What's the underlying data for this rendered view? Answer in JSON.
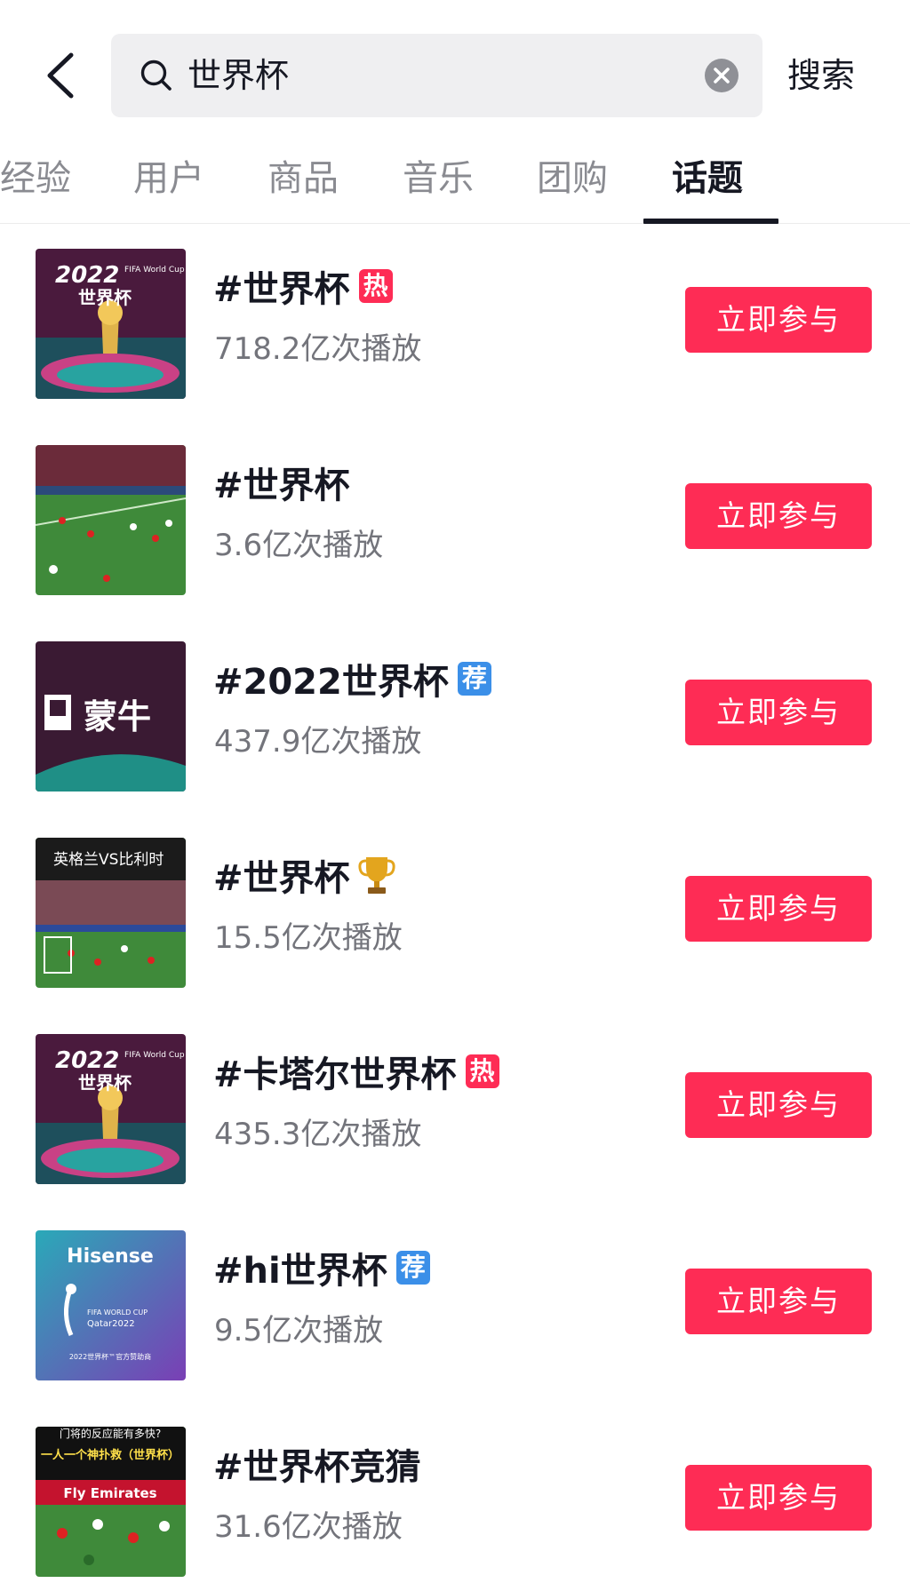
{
  "header": {
    "back_icon": "chevron-left-icon",
    "search_query": "世界杯",
    "search_icon": "search-icon",
    "clear_icon": "clear-circle-icon",
    "search_button": "搜索"
  },
  "tabs": [
    {
      "label": "经验",
      "active": false
    },
    {
      "label": "用户",
      "active": false
    },
    {
      "label": "商品",
      "active": false
    },
    {
      "label": "音乐",
      "active": false
    },
    {
      "label": "团购",
      "active": false
    },
    {
      "label": "话题",
      "active": true
    }
  ],
  "topics": [
    {
      "title": "#世界杯",
      "badge": "热",
      "badge_type": "hot",
      "plays": "718.2亿次播放",
      "button": "立即参与",
      "thumb_texts": [
        "2022",
        "世界杯",
        "FIFA World Cup"
      ]
    },
    {
      "title": "#世界杯",
      "badge": "",
      "badge_type": "",
      "plays": "3.6亿次播放",
      "button": "立即参与",
      "thumb_texts": []
    },
    {
      "title": "#2022世界杯",
      "badge": "荐",
      "badge_type": "rec",
      "plays": "437.9亿次播放",
      "button": "立即参与",
      "thumb_texts": [
        "蒙牛"
      ]
    },
    {
      "title": "#世界杯",
      "badge": "trophy-icon",
      "badge_type": "trophy",
      "plays": "15.5亿次播放",
      "button": "立即参与",
      "thumb_texts": [
        "英格兰VS比利时"
      ]
    },
    {
      "title": "#卡塔尔世界杯",
      "badge": "热",
      "badge_type": "hot",
      "plays": "435.3亿次播放",
      "button": "立即参与",
      "thumb_texts": [
        "2022",
        "世界杯",
        "FIFA World Cup"
      ]
    },
    {
      "title": "#hi世界杯",
      "badge": "荐",
      "badge_type": "rec",
      "plays": "9.5亿次播放",
      "button": "立即参与",
      "thumb_texts": [
        "Hisense",
        "FIFA WORLD CUP",
        "Qatar2022",
        "2022世界杯™官方赞助商"
      ]
    },
    {
      "title": "#世界杯竞猜",
      "badge": "",
      "badge_type": "",
      "plays": "31.6亿次播放",
      "button": "立即参与",
      "thumb_texts": [
        "门将的反应能有多快?",
        "一人一个神扑救（世界杯）",
        "Fly Emirates"
      ]
    }
  ],
  "colors": {
    "accent": "#fe2c55",
    "recommend": "#3b8fe8",
    "text_primary": "#161823",
    "text_secondary": "#73747b",
    "search_bg": "#efeff1"
  }
}
